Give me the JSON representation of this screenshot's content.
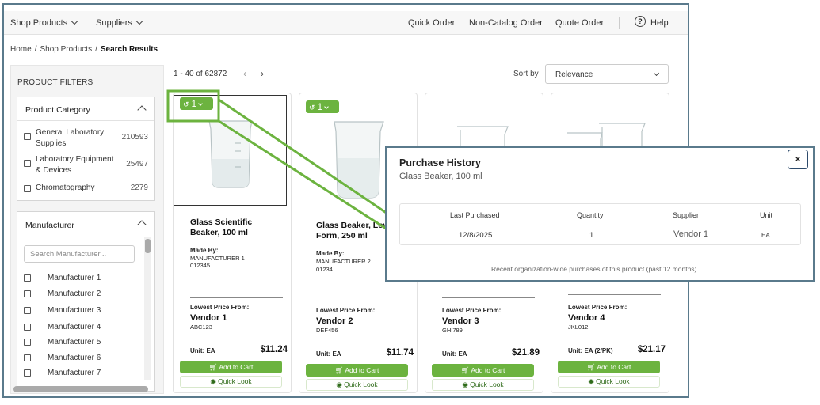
{
  "topnav": {
    "shop_products": "Shop Products",
    "suppliers": "Suppliers",
    "quick_order": "Quick Order",
    "non_catalog_order": "Non-Catalog Order",
    "quote_order": "Quote Order",
    "help": "Help"
  },
  "breadcrumb": {
    "home": "Home",
    "shop_products": "Shop Products",
    "current": "Search Results"
  },
  "filters": {
    "title": "PRODUCT FILTERS",
    "category": {
      "heading": "Product Category",
      "items": [
        {
          "label_line1": "General Laboratory",
          "label_line2": "Supplies",
          "count": "210593"
        },
        {
          "label_line1": "Laboratory Equipment",
          "label_line2": "& Devices",
          "count": "25497"
        },
        {
          "label_line1": "Chromatography",
          "label_line2": "",
          "count": "2279"
        }
      ]
    },
    "manufacturer": {
      "heading": "Manufacturer",
      "search_placeholder": "Search Manufacturer...",
      "items": [
        "Manufacturer 1",
        "Manufacturer 2",
        "Manufacturer 3",
        "Manufacturer 4",
        "Manufacturer 5",
        "Manufacturer 6",
        "Manufacturer 7"
      ]
    }
  },
  "results": {
    "count_text": "1 - 40 of 62872",
    "sort_label": "Sort by",
    "sort_value": "Relevance"
  },
  "products": [
    {
      "name": "Glass Scientific Beaker, 100 ml",
      "made_by_label": "Made By:",
      "manufacturer": "MANUFACTURER 1",
      "mfr_code": "012345",
      "lowest_label": "Lowest Price From:",
      "vendor": "Vendor 1",
      "vendor_code": "ABC123",
      "unit": "Unit: EA",
      "price": "$11.24",
      "cart": "Add to Cart",
      "quick_look": "Quick Look",
      "history_count": "1"
    },
    {
      "name": "Glass Beaker, Low Form, 250 ml",
      "made_by_label": "Made By:",
      "manufacturer": "MANUFACTURER 2",
      "mfr_code": "01234",
      "lowest_label": "Lowest Price From:",
      "vendor": "Vendor 2",
      "vendor_code": "DEF456",
      "unit": "Unit: EA",
      "price": "$11.74",
      "cart": "Add to Cart",
      "quick_look": "Quick Look",
      "history_count": "1"
    },
    {
      "name": "",
      "made_by_label": "",
      "manufacturer": "",
      "mfr_code": "",
      "lowest_label": "Lowest Price From:",
      "vendor": "Vendor 3",
      "vendor_code": "GHI789",
      "unit": "Unit: EA",
      "price": "$21.89",
      "cart": "Add to Cart",
      "quick_look": "Quick Look",
      "history_count": ""
    },
    {
      "name": "",
      "made_by_label": "",
      "manufacturer": "",
      "mfr_code": "",
      "lowest_label": "Lowest Price From:",
      "vendor": "Vendor 4",
      "vendor_code": "JKL012",
      "unit": "Unit: EA (2/PK)",
      "price": "$21.17",
      "cart": "Add to Cart",
      "quick_look": "Quick Look",
      "history_count": ""
    }
  ],
  "popup": {
    "title": "Purchase History",
    "subtitle": "Glass Beaker, 100 ml",
    "close": "×",
    "columns": [
      "Last Purchased",
      "Quantity",
      "Supplier",
      "Unit"
    ],
    "row": [
      "12/8/2025",
      "1",
      "Vendor 1",
      "EA"
    ],
    "footer": "Recent organization-wide purchases of this product (past 12 months)"
  },
  "colors": {
    "accent": "#6cb33f",
    "frame": "#5a7a8c"
  },
  "icons": {
    "help": "help-circle-icon",
    "history": "history-icon",
    "cart": "cart-icon",
    "eye": "eye-icon"
  }
}
